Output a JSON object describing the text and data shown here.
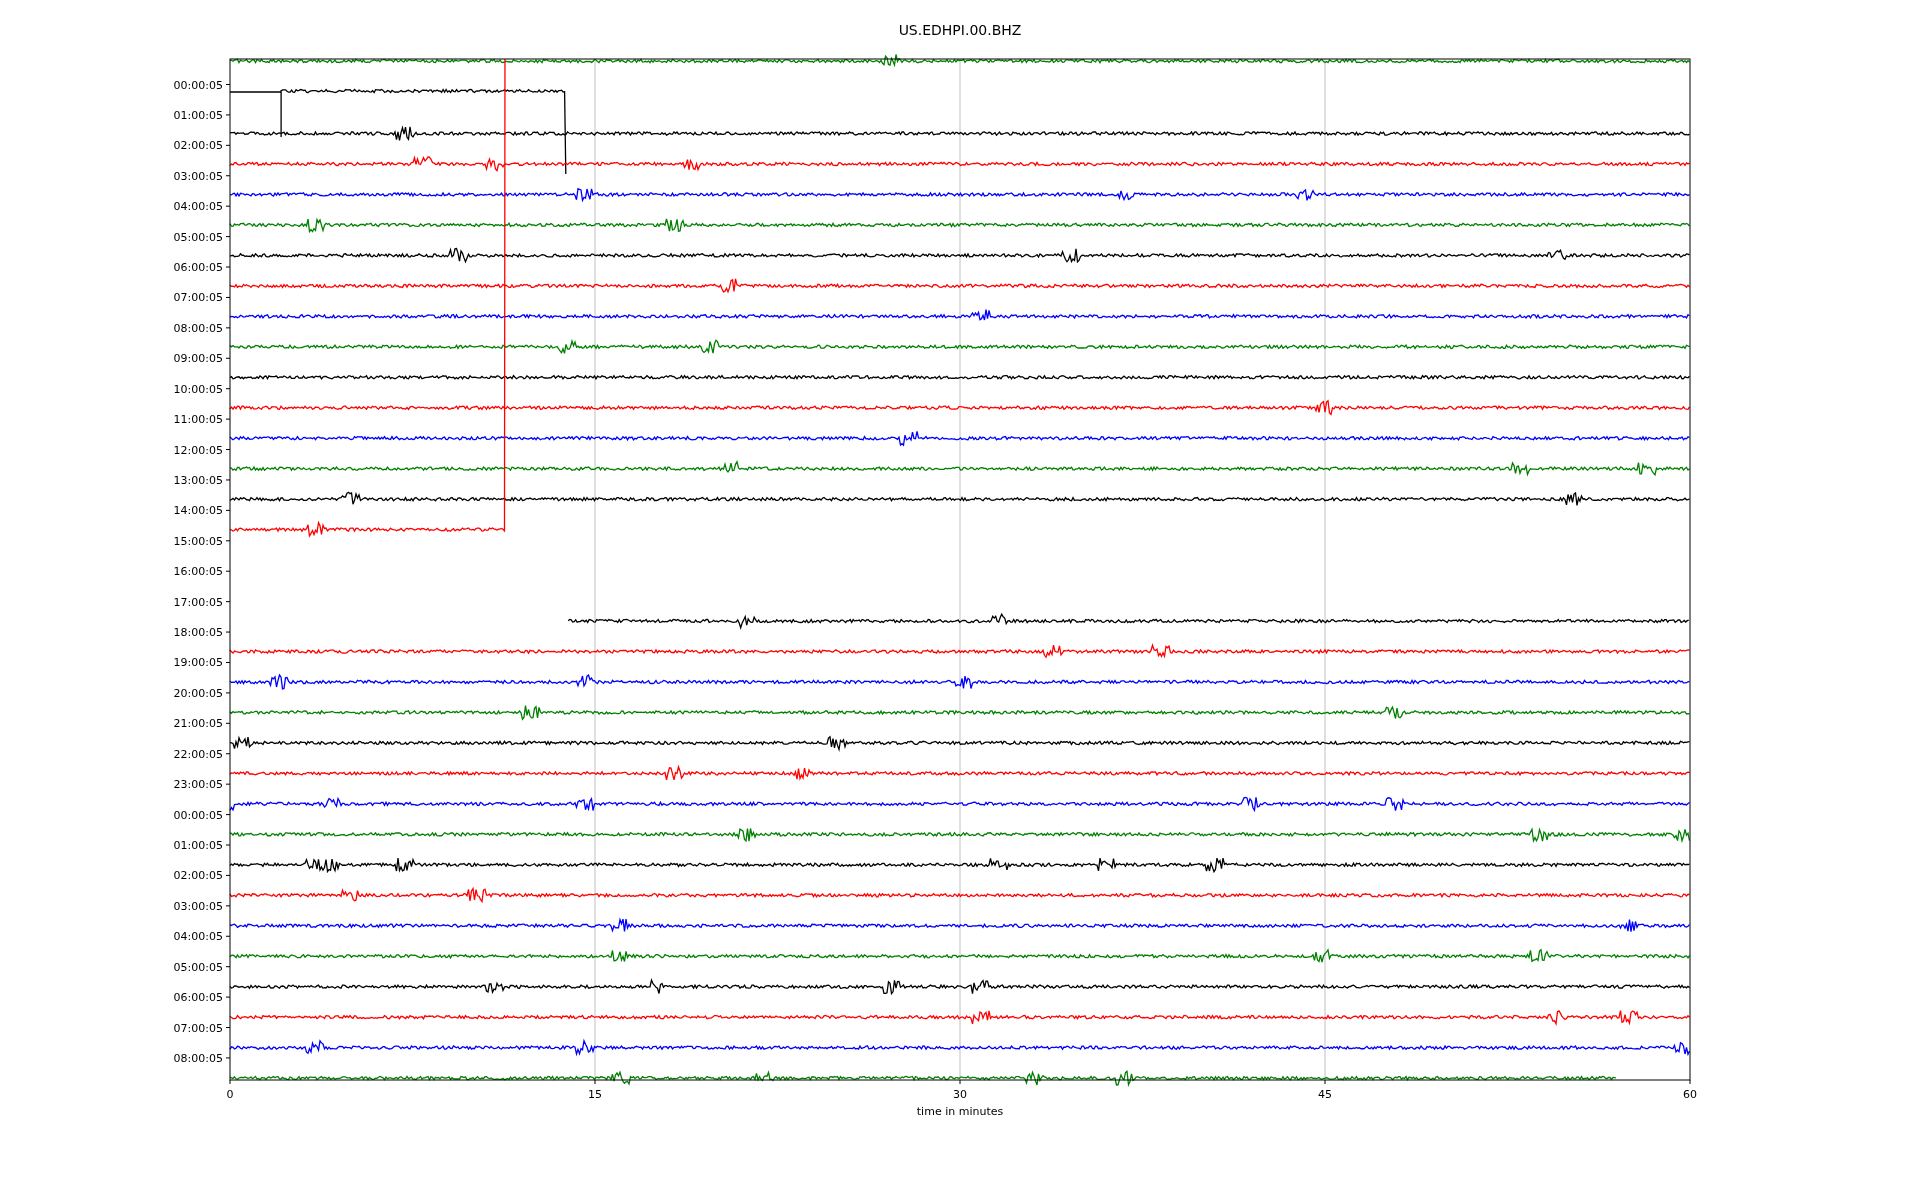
{
  "title": "US.EDHPI.00.BHZ",
  "y_labels": [
    "00:00:05",
    "01:00:05",
    "02:00:05",
    "03:00:05",
    "04:00:05",
    "05:00:05",
    "06:00:05",
    "07:00:05",
    "08:00:05",
    "09:00:05",
    "10:00:05",
    "11:00:05",
    "12:00:05",
    "13:00:05",
    "14:00:05",
    "15:00:05",
    "16:00:05",
    "17:00:05",
    "18:00:05",
    "19:00:05",
    "20:00:05",
    "21:00:05",
    "22:00:05",
    "23:00:05",
    "00:00:05",
    "01:00:05",
    "02:00:05",
    "03:00:05",
    "04:00:05",
    "05:00:05",
    "06:00:05",
    "07:00:05",
    "08:00:05"
  ],
  "x_ticks": [
    "0",
    "15",
    "30",
    "45",
    "60"
  ],
  "x_label": "time in minutes",
  "traces": [
    {
      "kind": "noise",
      "color": "#008000"
    },
    {
      "kind": "step-down",
      "color": "#000000"
    },
    {
      "kind": "noise",
      "color": "#000000"
    },
    {
      "kind": "noise",
      "color": "#ff0000"
    },
    {
      "kind": "noise",
      "color": "#0000ff"
    },
    {
      "kind": "noise",
      "color": "#008000"
    },
    {
      "kind": "noise",
      "color": "#000000"
    },
    {
      "kind": "noise",
      "color": "#ff0000"
    },
    {
      "kind": "noise",
      "color": "#0000ff"
    },
    {
      "kind": "noise",
      "color": "#008000"
    },
    {
      "kind": "noise",
      "color": "#000000"
    },
    {
      "kind": "noise",
      "color": "#ff0000"
    },
    {
      "kind": "noise",
      "color": "#0000ff"
    },
    {
      "kind": "noise",
      "color": "#008000"
    },
    {
      "kind": "noise",
      "color": "#000000"
    },
    {
      "kind": "step-up",
      "color": "#ff0000"
    },
    {
      "kind": "gap"
    },
    {
      "kind": "gap"
    },
    {
      "kind": "late-start",
      "color": "#000000"
    },
    {
      "kind": "noise",
      "color": "#ff0000"
    },
    {
      "kind": "noise",
      "color": "#0000ff"
    },
    {
      "kind": "noise",
      "color": "#008000"
    },
    {
      "kind": "noise",
      "color": "#000000"
    },
    {
      "kind": "noise",
      "color": "#ff0000"
    },
    {
      "kind": "noise",
      "color": "#0000ff"
    },
    {
      "kind": "noise",
      "color": "#008000"
    },
    {
      "kind": "noise",
      "color": "#000000"
    },
    {
      "kind": "noise",
      "color": "#ff0000"
    },
    {
      "kind": "noise",
      "color": "#0000ff"
    },
    {
      "kind": "noise",
      "color": "#008000"
    },
    {
      "kind": "noise",
      "color": "#000000"
    },
    {
      "kind": "noise",
      "color": "#ff0000"
    },
    {
      "kind": "noise",
      "color": "#0000ff"
    },
    {
      "kind": "early-end",
      "color": "#008000"
    }
  ]
}
